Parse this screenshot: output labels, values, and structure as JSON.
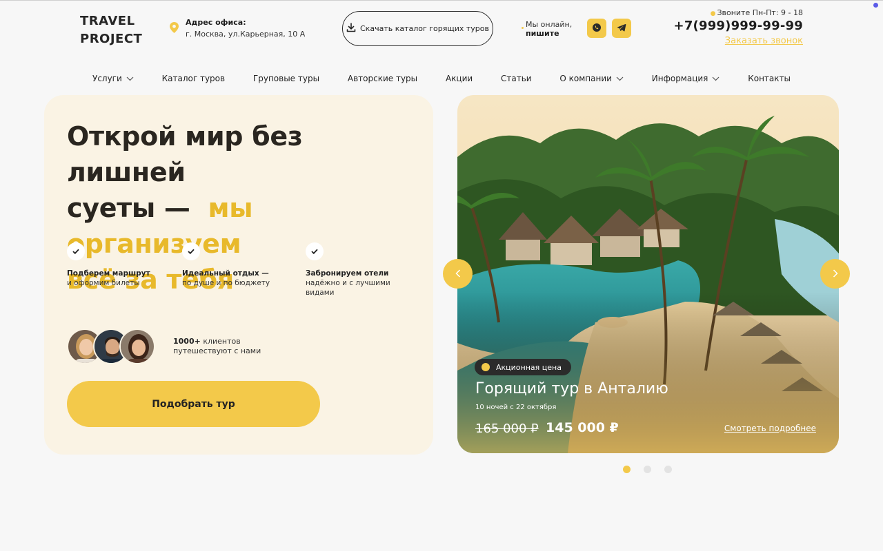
{
  "colors": {
    "accent": "#f3c94a",
    "accent_text": "#e8b92b",
    "hero_bg": "#faf3e4",
    "dark": "#2b2b2b"
  },
  "header": {
    "logo_line1": "TRAVEL",
    "logo_line2": "PROJECT",
    "office_label": "Адрес офиса:",
    "office_address": "г. Москва, ул.Карьерная, 10 А",
    "catalog_button": "Скачать каталог горящих туров",
    "online_line1": "Мы онлайн,",
    "online_line2": "пишите",
    "messengers": [
      {
        "name": "WhatsApp",
        "icon": "whatsapp-icon"
      },
      {
        "name": "Telegram",
        "icon": "telegram-icon"
      }
    ],
    "hours": "Звоните Пн-Пт: 9 - 18",
    "phone": "+7(999)999-99-99",
    "callback": "Заказать звонок"
  },
  "nav": {
    "items": [
      {
        "label": "Услуги",
        "dropdown": true
      },
      {
        "label": "Каталог туров",
        "dropdown": false
      },
      {
        "label": "Груповые туры",
        "dropdown": false
      },
      {
        "label": "Авторские туры",
        "dropdown": false
      },
      {
        "label": "Акции",
        "dropdown": false
      },
      {
        "label": "Статьи",
        "dropdown": false
      },
      {
        "label": "О компании",
        "dropdown": true
      },
      {
        "label": "Информация",
        "dropdown": true
      },
      {
        "label": "Контакты",
        "dropdown": false
      }
    ]
  },
  "hero": {
    "headline_dark_1": "Открой мир без лишней",
    "headline_dark_2": "суеты —",
    "headline_accent_1": "мы организуем",
    "headline_accent_2": "всё за тебя",
    "features": [
      {
        "title": "Подберем маршрут",
        "lines": [
          "и оформим билеты"
        ]
      },
      {
        "title": "Идеальный отдых —",
        "lines": [
          "по душе и по бюджету"
        ]
      },
      {
        "title": "Забронируем отели",
        "lines": [
          "надёжно и с лучшими",
          "видами"
        ]
      }
    ],
    "clients_count": "1000+",
    "clients_word": "клиентов",
    "clients_line2": "путешествуют с нами",
    "cta": "Подобрать тур"
  },
  "slider": {
    "badge": "Акционная цена",
    "title": "Горящий тур в Анталию",
    "subtitle": "10 ночей с 22 октября",
    "old_price": "165 000 ₽",
    "new_price": "145 000 ₽",
    "more_link": "Смотреть подробнее",
    "pages": 3,
    "active_page": 1
  }
}
